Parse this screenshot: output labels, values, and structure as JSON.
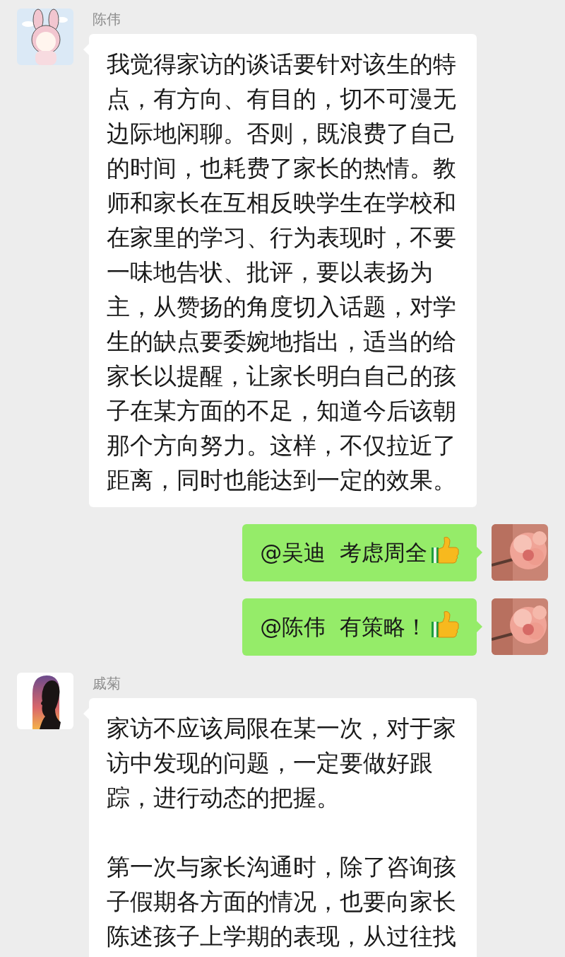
{
  "messages": [
    {
      "kind": "incoming",
      "sender": "陈伟",
      "avatar": {
        "kind": "cartoon"
      },
      "paragraphs": [
        "我觉得家访的谈话要针对该生的特点，有方向、有目的，切不可漫无边际地闲聊。否则，既浪费了自己的时间，也耗费了家长的热情。教师和家长在互相反映学生在学校和在家里的学习、行为表现时，不要一味地告状、批评，要以表扬为主，从赞扬的角度切入话题，对学生的缺点要委婉地指出，适当的给家长以提醒，让家长明白自己的孩子在某方面的不足，知道今后该朝那个方向努力。这样，不仅拉近了距离，同时也能达到一定的效果。"
      ]
    },
    {
      "kind": "outgoing",
      "avatar": {
        "kind": "picture"
      },
      "paragraphs": [
        "@吴迪  考虑周全"
      ],
      "emoji": {
        "kind": "thumbs-up"
      }
    },
    {
      "kind": "outgoing",
      "avatar": {
        "kind": "picture"
      },
      "paragraphs": [
        "@陈伟  有策略！"
      ],
      "emoji": {
        "kind": "thumbs-up"
      }
    },
    {
      "kind": "incoming",
      "sender": "戚菊",
      "avatar": {
        "kind": "silhouette"
      },
      "paragraphs": [
        "家访不应该局限在某一次，对于家访中发现的问题，一定要做好跟踪，进行动态的把握。",
        "第一次与家长沟通时，除了咨询孩子假期各方面的情况，也要向家长陈述孩子上学期的表现，从过往找"
      ]
    }
  ]
}
